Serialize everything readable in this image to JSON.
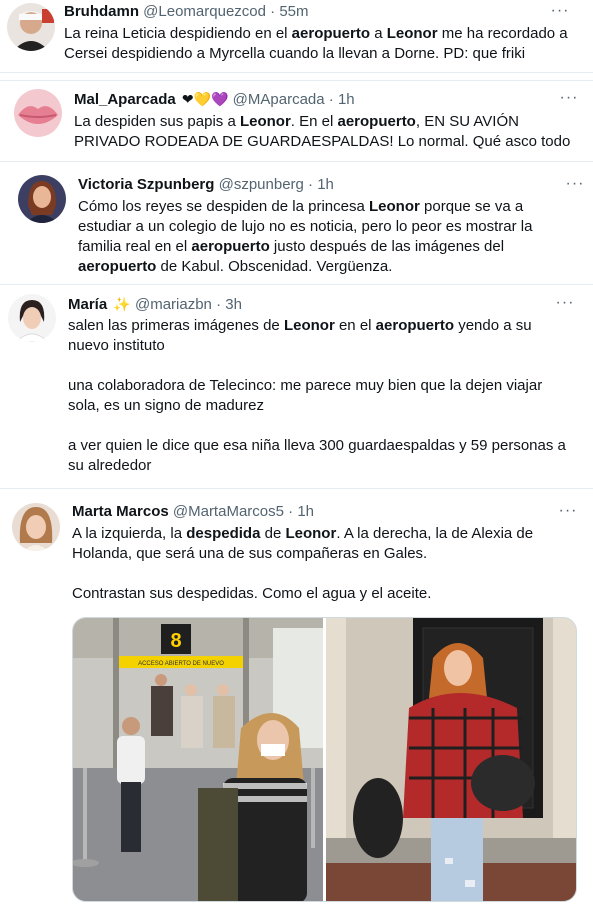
{
  "tweets": [
    {
      "name": "Bruhdamn",
      "handle": "@Leomarquezcod",
      "sep": "·",
      "time": "55m",
      "text_parts": [
        "La reina Leticia despidiendo en el ",
        "aeropuerto",
        " a ",
        "Leonor",
        " me ha recordado a Cersei despidiendo a Myrcella cuando la llevan a Dorne. PD: que friki"
      ]
    },
    {
      "name": "Mal_Aparcada",
      "emojis": "❤💛💜",
      "handle": "@MAparcada",
      "sep": "·",
      "time": "1h",
      "text_parts": [
        "La despiden sus papis a ",
        "Leonor",
        ". En el ",
        "aeropuerto",
        ", EN SU AVIÓN PRIVADO RODEADA DE GUARDAESPALDAS! Lo normal. Qué asco todo"
      ]
    },
    {
      "name": "Victoria Szpunberg",
      "handle": "@szpunberg",
      "sep": "·",
      "time": "1h",
      "text_parts": [
        "Cómo los reyes se despiden de la princesa ",
        "Leonor",
        " porque se va a estudiar a un colegio de lujo no es noticia, pero lo peor es mostrar la familia real en el ",
        "aeropuerto",
        " justo después de las imágenes del ",
        "aeropuerto",
        " de Kabul. Obscenidad. Vergüenza."
      ]
    },
    {
      "name": "María",
      "emojis": "✨",
      "handle": "@mariazbn",
      "sep": "·",
      "time": "3h",
      "p1_parts": [
        "salen las primeras imágenes de ",
        "Leonor",
        " en el ",
        "aeropuerto",
        " yendo a su nuevo instituto"
      ],
      "p2": "una colaboradora de Telecinco: me parece muy bien que la dejen viajar sola, es un signo de madurez",
      "p3": "a ver quien le dice que esa niña lleva 300 guardaespaldas y 59 personas a su alrededor"
    },
    {
      "name": "Marta Marcos",
      "handle": "@MartaMarcos5",
      "sep": "·",
      "time": "1h",
      "p1_parts": [
        "A la izquierda, la ",
        "despedida",
        " de ",
        "Leonor",
        ". A la derecha, la de Alexia de Holanda, que será una de sus compañeras en Gales."
      ],
      "p2": "Contrastan sus despedidas. Como el agua y el aceite.",
      "photo_sign": "8",
      "photo_banner": "ACCESO ABIERTO DE NUEVO"
    }
  ],
  "more_label": "···",
  "colors": {
    "text": "#0f1419",
    "meta": "#536471",
    "border": "#e6ecf0"
  }
}
